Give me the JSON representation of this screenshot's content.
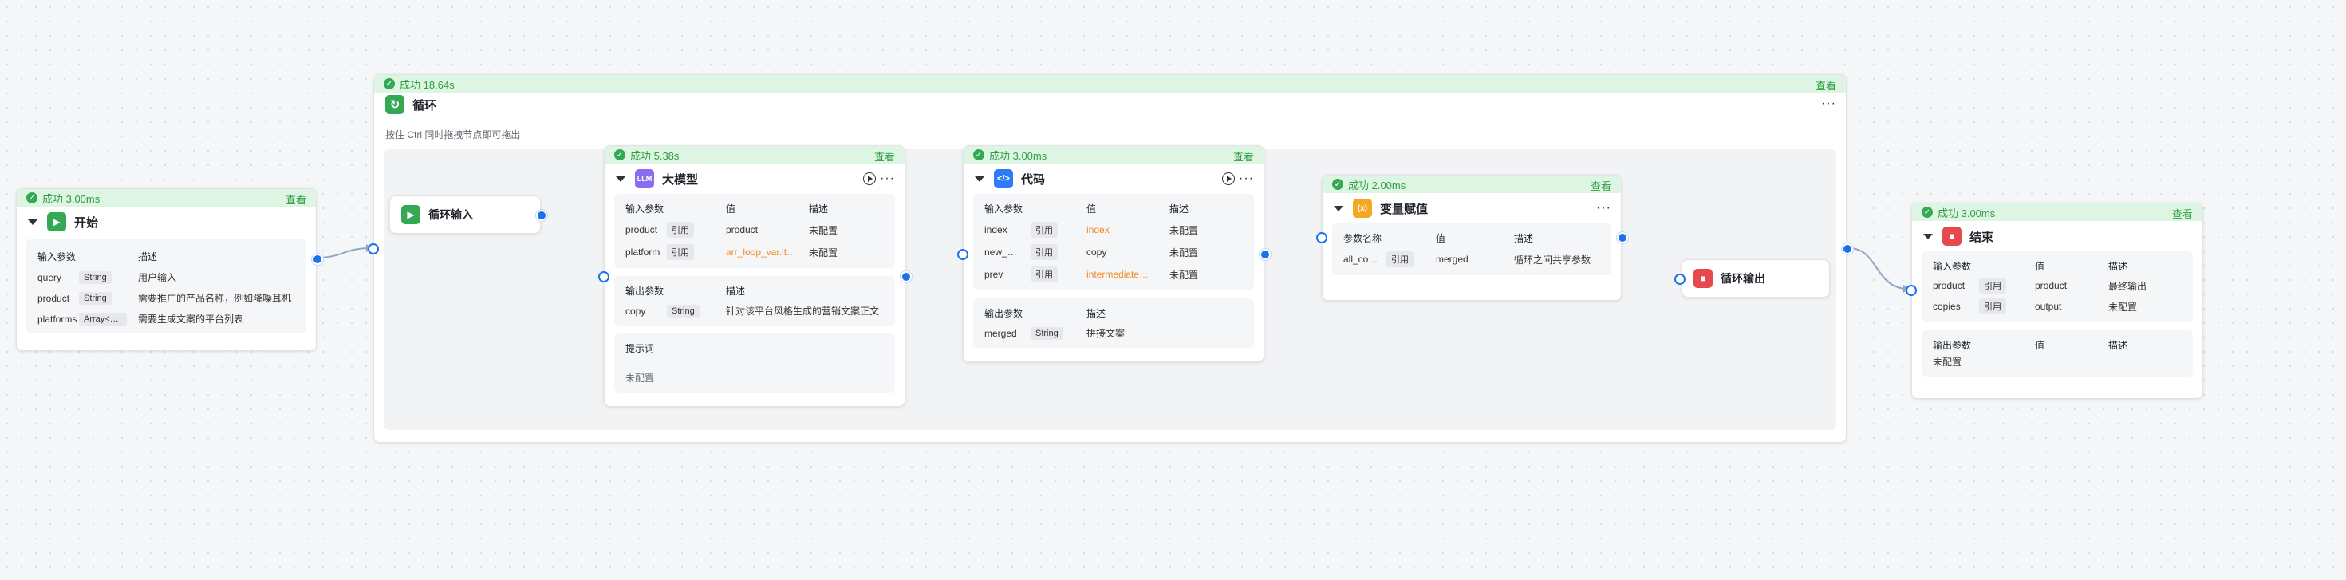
{
  "nodes": {
    "start": {
      "status": "成功 3.00ms",
      "view": "查看",
      "title": "开始",
      "headers": [
        "输入参数",
        "描述"
      ],
      "rows": [
        {
          "name": "query",
          "type": "String",
          "desc": "用户输入"
        },
        {
          "name": "product",
          "type": "String",
          "desc": "需要推广的产品名称，例如降噪耳机"
        },
        {
          "name": "platforms",
          "type": "Array<String>",
          "desc": "需要生成文案的平台列表"
        }
      ]
    },
    "loop": {
      "status": "成功 18.64s",
      "view": "查看",
      "title": "循环",
      "hint": "按住 Ctrl 同时拖拽节点即可拖出"
    },
    "loop_input": {
      "title": "循环输入"
    },
    "llm": {
      "status": "成功 5.38s",
      "view": "查看",
      "title": "大模型",
      "icon_text": "LLM",
      "in_headers": [
        "输入参数",
        "值",
        "描述"
      ],
      "in_rows": [
        {
          "name": "product",
          "ref": "引用",
          "value": "product",
          "desc": "未配置"
        },
        {
          "name": "platform",
          "ref": "引用",
          "value": "arr_loop_var.item",
          "desc": "未配置"
        }
      ],
      "out_headers": [
        "输出参数",
        "描述"
      ],
      "out_rows": [
        {
          "name": "copy",
          "type": "String",
          "desc": "针对该平台风格生成的营销文案正文"
        }
      ],
      "prompt_label": "提示词",
      "prompt_value": "未配置"
    },
    "code": {
      "status": "成功 3.00ms",
      "view": "查看",
      "title": "代码",
      "in_headers": [
        "输入参数",
        "值",
        "描述"
      ],
      "in_rows": [
        {
          "name": "index",
          "ref": "引用",
          "value": "index",
          "desc": "未配置"
        },
        {
          "name": "new_copy",
          "ref": "引用",
          "value": "copy",
          "desc": "未配置"
        },
        {
          "name": "prev",
          "ref": "引用",
          "value": "intermediate_list",
          "desc": "未配置"
        }
      ],
      "out_headers": [
        "输出参数",
        "描述"
      ],
      "out_rows": [
        {
          "name": "merged",
          "type": "String",
          "desc": "拼接文案"
        }
      ]
    },
    "assign": {
      "status": "成功 2.00ms",
      "view": "查看",
      "title": "变量赋值",
      "icon_text": "(x)",
      "headers": [
        "参数名称",
        "值",
        "描述"
      ],
      "rows": [
        {
          "name": "all_copies",
          "ref": "引用",
          "value": "merged",
          "desc": "循环之间共享参数"
        }
      ]
    },
    "loop_output": {
      "title": "循环输出"
    },
    "end": {
      "status": "成功 3.00ms",
      "view": "查看",
      "title": "结束",
      "in_headers": [
        "输入参数",
        "值",
        "描述"
      ],
      "in_rows": [
        {
          "name": "product",
          "ref": "引用",
          "value": "product",
          "desc": "最终输出"
        },
        {
          "name": "copies",
          "ref": "引用",
          "value": "output",
          "desc": "未配置"
        }
      ],
      "out_headers": [
        "输出参数",
        "值",
        "描述"
      ],
      "out_value": "未配置"
    }
  },
  "colors": {
    "success_bg": "#dff5e3",
    "success_text": "#2f9e44",
    "start_icon": "#34a853",
    "loop_icon": "#34a853",
    "llm_icon": "#8b6cf0",
    "code_icon": "#2b7cf6",
    "assign_icon": "#f5a623",
    "stop_icon": "#e5484d",
    "port": "#1a73e8",
    "ref_value": "#f08a24"
  }
}
